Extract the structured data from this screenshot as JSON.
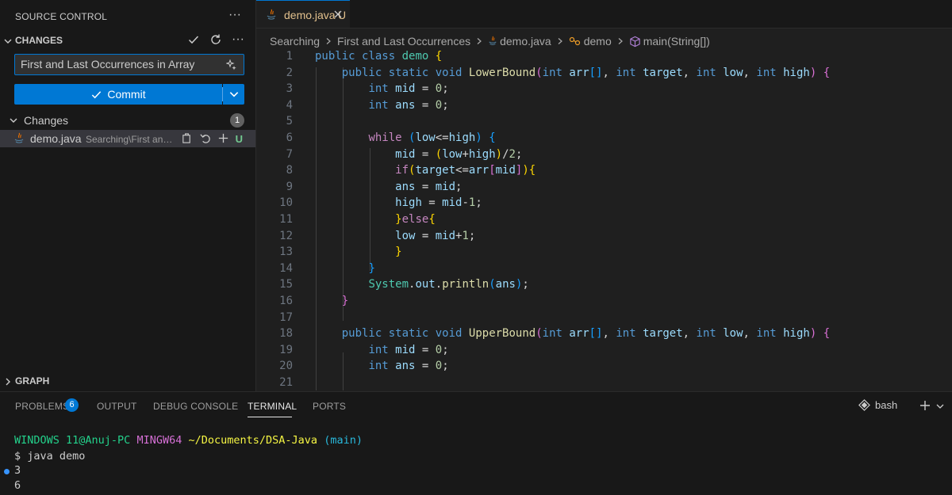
{
  "sidebar": {
    "title": "SOURCE CONTROL",
    "more": "···",
    "section_label": "CHANGES",
    "commit_message": "First and Last Occurrences in Array",
    "commit_label": "Commit",
    "changes_label": "Changes",
    "changes_count": "1",
    "file": {
      "name": "demo.java",
      "path": "Searching\\First and Last Occurrences",
      "status": "U"
    },
    "graph_label": "GRAPH"
  },
  "editor": {
    "tab": {
      "name": "demo.java",
      "status": "U"
    },
    "breadcrumb": [
      "Searching",
      "First and Last Occurrences",
      "demo.java",
      "demo",
      "main(String[])"
    ]
  },
  "panel": {
    "tabs": [
      "PROBLEMS",
      "OUTPUT",
      "DEBUG CONSOLE",
      "TERMINAL",
      "PORTS"
    ],
    "problems_count": "6",
    "active_tab": "TERMINAL",
    "shell": "bash",
    "terminal": {
      "user": "WINDOWS 11@Anuj-PC",
      "env": "MINGW64",
      "cwd": "~/Documents/DSA-Java",
      "branch": "(main)",
      "command": "$ java demo",
      "output": [
        "3",
        "6"
      ]
    }
  },
  "colors": {
    "accent": "#0078d4",
    "untracked": "#73c991",
    "modified_tab": "#e2c08d"
  },
  "code_lines": [
    [
      [
        "k",
        "public "
      ],
      [
        "k",
        "class "
      ],
      [
        "t",
        "demo "
      ],
      [
        "b1",
        "{"
      ]
    ],
    [
      [
        "p",
        "    "
      ],
      [
        "k",
        "public "
      ],
      [
        "k",
        "static "
      ],
      [
        "k",
        "void "
      ],
      [
        "f",
        "LowerBound"
      ],
      [
        "b2",
        "("
      ],
      [
        "k",
        "int "
      ],
      [
        "v",
        "arr"
      ],
      [
        "b3",
        "[]"
      ],
      [
        "p",
        ", "
      ],
      [
        "k",
        "int "
      ],
      [
        "v",
        "target"
      ],
      [
        "p",
        ", "
      ],
      [
        "k",
        "int "
      ],
      [
        "v",
        "low"
      ],
      [
        "p",
        ", "
      ],
      [
        "k",
        "int "
      ],
      [
        "v",
        "high"
      ],
      [
        "b2",
        ")"
      ],
      [
        "p",
        " "
      ],
      [
        "b2",
        "{"
      ]
    ],
    [
      [
        "p",
        "        "
      ],
      [
        "k",
        "int "
      ],
      [
        "v",
        "mid"
      ],
      [
        "p",
        " = "
      ],
      [
        "n",
        "0"
      ],
      [
        "p",
        ";"
      ]
    ],
    [
      [
        "p",
        "        "
      ],
      [
        "k",
        "int "
      ],
      [
        "v",
        "ans"
      ],
      [
        "p",
        " = "
      ],
      [
        "n",
        "0"
      ],
      [
        "p",
        ";"
      ]
    ],
    [
      [
        "p",
        ""
      ]
    ],
    [
      [
        "p",
        "        "
      ],
      [
        "c",
        "while "
      ],
      [
        "b3",
        "("
      ],
      [
        "v",
        "low"
      ],
      [
        "p",
        "<="
      ],
      [
        "v",
        "high"
      ],
      [
        "b3",
        ")"
      ],
      [
        "p",
        " "
      ],
      [
        "b3",
        "{"
      ]
    ],
    [
      [
        "p",
        "            "
      ],
      [
        "v",
        "mid"
      ],
      [
        "p",
        " = "
      ],
      [
        "b1",
        "("
      ],
      [
        "v",
        "low"
      ],
      [
        "p",
        "+"
      ],
      [
        "v",
        "high"
      ],
      [
        "b1",
        ")"
      ],
      [
        "p",
        "/"
      ],
      [
        "n",
        "2"
      ],
      [
        "p",
        ";"
      ]
    ],
    [
      [
        "p",
        "            "
      ],
      [
        "c",
        "if"
      ],
      [
        "b1",
        "("
      ],
      [
        "v",
        "target"
      ],
      [
        "p",
        "<="
      ],
      [
        "v",
        "arr"
      ],
      [
        "b2",
        "["
      ],
      [
        "v",
        "mid"
      ],
      [
        "b2",
        "]"
      ],
      [
        "b1",
        ")"
      ],
      [
        "b1",
        "{"
      ]
    ],
    [
      [
        "p",
        "            "
      ],
      [
        "v",
        "ans"
      ],
      [
        "p",
        " = "
      ],
      [
        "v",
        "mid"
      ],
      [
        "p",
        ";"
      ]
    ],
    [
      [
        "p",
        "            "
      ],
      [
        "v",
        "high"
      ],
      [
        "p",
        " = "
      ],
      [
        "v",
        "mid"
      ],
      [
        "p",
        "-"
      ],
      [
        "n",
        "1"
      ],
      [
        "p",
        ";"
      ]
    ],
    [
      [
        "p",
        "            "
      ],
      [
        "b1",
        "}"
      ],
      [
        "c",
        "else"
      ],
      [
        "b1",
        "{"
      ]
    ],
    [
      [
        "p",
        "            "
      ],
      [
        "v",
        "low"
      ],
      [
        "p",
        " = "
      ],
      [
        "v",
        "mid"
      ],
      [
        "p",
        "+"
      ],
      [
        "n",
        "1"
      ],
      [
        "p",
        ";"
      ]
    ],
    [
      [
        "p",
        "            "
      ],
      [
        "b1",
        "}"
      ]
    ],
    [
      [
        "p",
        "        "
      ],
      [
        "b3",
        "}"
      ]
    ],
    [
      [
        "p",
        "        "
      ],
      [
        "t",
        "System"
      ],
      [
        "p",
        "."
      ],
      [
        "v",
        "out"
      ],
      [
        "p",
        "."
      ],
      [
        "f",
        "println"
      ],
      [
        "b3",
        "("
      ],
      [
        "v",
        "ans"
      ],
      [
        "b3",
        ")"
      ],
      [
        "p",
        ";"
      ]
    ],
    [
      [
        "p",
        "    "
      ],
      [
        "b2",
        "}"
      ]
    ],
    [
      [
        "p",
        ""
      ]
    ],
    [
      [
        "p",
        "    "
      ],
      [
        "k",
        "public "
      ],
      [
        "k",
        "static "
      ],
      [
        "k",
        "void "
      ],
      [
        "f",
        "UpperBound"
      ],
      [
        "b2",
        "("
      ],
      [
        "k",
        "int "
      ],
      [
        "v",
        "arr"
      ],
      [
        "b3",
        "[]"
      ],
      [
        "p",
        ", "
      ],
      [
        "k",
        "int "
      ],
      [
        "v",
        "target"
      ],
      [
        "p",
        ", "
      ],
      [
        "k",
        "int "
      ],
      [
        "v",
        "low"
      ],
      [
        "p",
        ", "
      ],
      [
        "k",
        "int "
      ],
      [
        "v",
        "high"
      ],
      [
        "b2",
        ")"
      ],
      [
        "p",
        " "
      ],
      [
        "b2",
        "{"
      ]
    ],
    [
      [
        "p",
        "        "
      ],
      [
        "k",
        "int "
      ],
      [
        "v",
        "mid"
      ],
      [
        "p",
        " = "
      ],
      [
        "n",
        "0"
      ],
      [
        "p",
        ";"
      ]
    ],
    [
      [
        "p",
        "        "
      ],
      [
        "k",
        "int "
      ],
      [
        "v",
        "ans"
      ],
      [
        "p",
        " = "
      ],
      [
        "n",
        "0"
      ],
      [
        "p",
        ";"
      ]
    ],
    [
      [
        "p",
        ""
      ]
    ]
  ]
}
